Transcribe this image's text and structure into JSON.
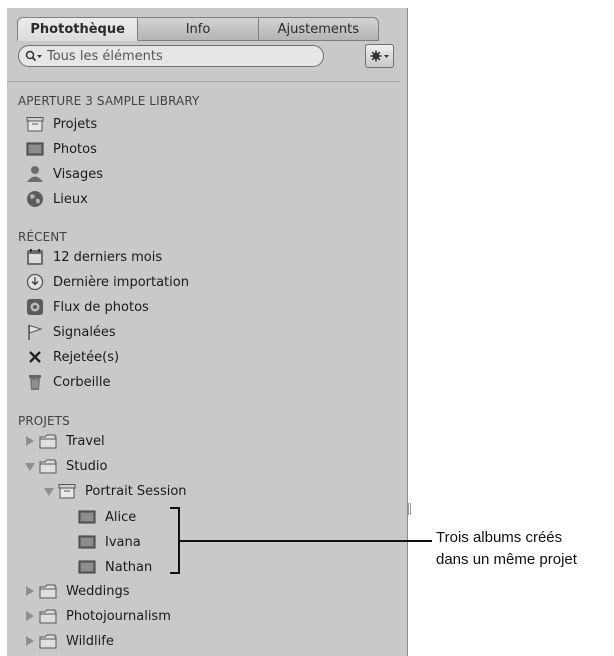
{
  "tabs": [
    "Photothèque",
    "Info",
    "Ajustements"
  ],
  "search": {
    "placeholder": "Tous les éléments"
  },
  "sections": {
    "library": {
      "title": "APERTURE 3 SAMPLE LIBRARY",
      "items": [
        {
          "label": "Projets",
          "icon": "projects-icon"
        },
        {
          "label": "Photos",
          "icon": "photos-icon"
        },
        {
          "label": "Visages",
          "icon": "faces-icon"
        },
        {
          "label": "Lieux",
          "icon": "places-icon"
        }
      ]
    },
    "recent": {
      "title": "RÉCENT",
      "items": [
        {
          "label": "12 derniers mois",
          "icon": "calendar-icon"
        },
        {
          "label": "Dernière importation",
          "icon": "last-import-icon"
        },
        {
          "label": "Flux de photos",
          "icon": "photo-stream-icon"
        },
        {
          "label": "Signalées",
          "icon": "flag-icon"
        },
        {
          "label": "Rejetée(s)",
          "icon": "rejected-icon"
        },
        {
          "label": "Corbeille",
          "icon": "trash-icon"
        }
      ]
    },
    "projects": {
      "title": "PROJETS",
      "items": [
        {
          "label": "Travel",
          "icon": "folder-icon"
        },
        {
          "label": "Studio",
          "icon": "folder-icon"
        },
        {
          "label": "Portrait Session",
          "icon": "project-icon"
        },
        {
          "label": "Alice",
          "icon": "album-icon"
        },
        {
          "label": "Ivana",
          "icon": "album-icon"
        },
        {
          "label": "Nathan",
          "icon": "album-icon"
        },
        {
          "label": "Weddings",
          "icon": "folder-icon"
        },
        {
          "label": "Photojournalism",
          "icon": "folder-icon"
        },
        {
          "label": "Wildlife",
          "icon": "folder-icon"
        }
      ]
    }
  },
  "callout": {
    "line1": "Trois albums créés",
    "line2": "dans un même projet"
  }
}
